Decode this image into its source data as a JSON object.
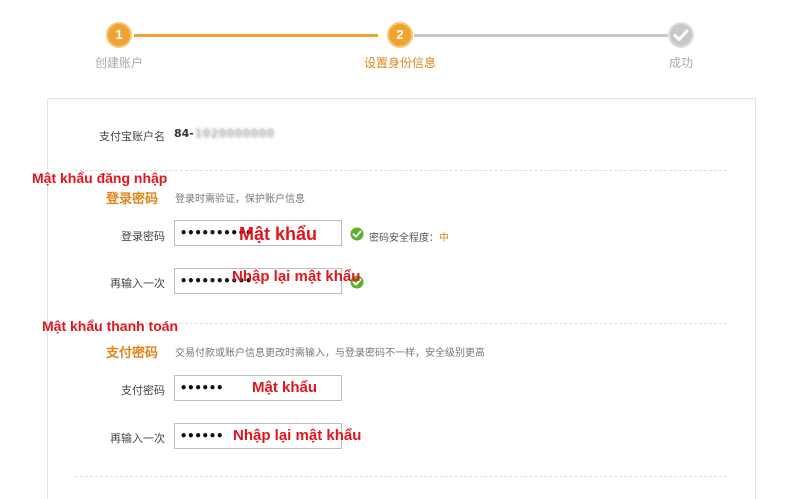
{
  "progress": {
    "steps": [
      {
        "number": "1",
        "label": "创建账户",
        "state": "done"
      },
      {
        "number": "2",
        "label": "设置身份信息",
        "state": "active"
      },
      {
        "number": "",
        "label": "成功",
        "state": "pending"
      }
    ],
    "colors": {
      "accent": "#f0a331",
      "pending": "#c8c8c8",
      "active_text": "#e0861a"
    }
  },
  "account": {
    "label": "支付宝账户名",
    "prefix": "84-",
    "masked_number": "1020000000"
  },
  "login_password": {
    "annotation": "Mật khẩu đăng nhập",
    "title": "登录密码",
    "description": "登录时需验证，保护账户信息",
    "password_label": "登录密码",
    "password_value": "••••••••••",
    "password_annotation": "Mật khẩu",
    "strength_label": "密码安全程度：",
    "strength_value": "中",
    "confirm_label": "再输入一次",
    "confirm_value": "••••••••••",
    "confirm_annotation": "Nhập lại mật khẩu"
  },
  "payment_password": {
    "annotation": "Mật khẩu thanh toán",
    "title": "支付密码",
    "description": "交易付款或账户信息更改时需输入，与登录密码不一样，安全级别更高",
    "password_label": "支付密码",
    "password_value": "••••••",
    "password_annotation": "Mật khẩu",
    "confirm_label": "再输入一次",
    "confirm_value": "••••••",
    "confirm_annotation": "Nhập lại mật khẩu"
  },
  "icons": {
    "step_done": "step-1-circle-icon",
    "step_active": "step-2-circle-icon",
    "step_pending": "check-circle-icon",
    "valid": "green-check-icon"
  }
}
